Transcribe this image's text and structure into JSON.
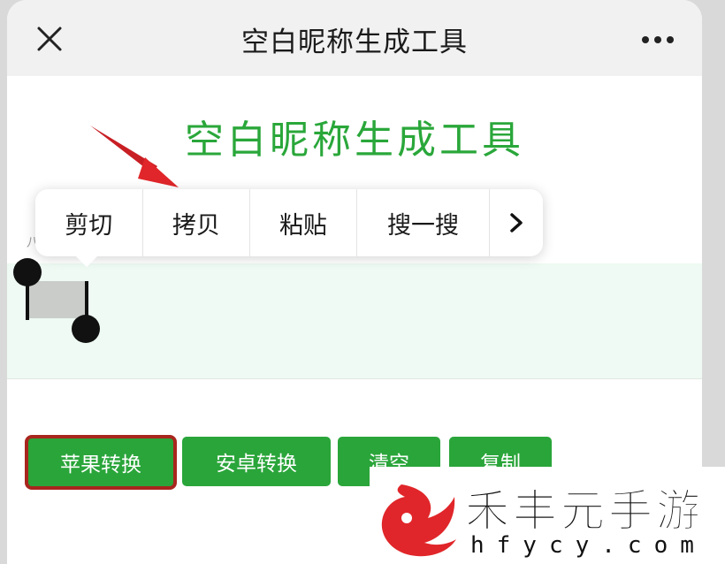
{
  "topbar": {
    "title": "空白昵称生成工具",
    "close_icon": "close-icon",
    "more_icon": "more-dots-icon"
  },
  "main": {
    "title": "空白昵称生成工具",
    "title_color": "#2aa73a"
  },
  "context_menu": {
    "items": [
      {
        "label": "剪切"
      },
      {
        "label": "拷贝"
      },
      {
        "label": "粘贴"
      },
      {
        "label": "搜一搜"
      }
    ],
    "more_icon": "chevron-right-icon"
  },
  "buttons": {
    "apple": "苹果转换",
    "android": "安卓转换",
    "clear": "清空",
    "copy": "复制"
  },
  "watermark": {
    "text": "禾丰元手游",
    "url": "hfycy.com"
  },
  "colors": {
    "accent_green": "#2aa53a",
    "highlight_border": "#a8261e",
    "arrow_red": "#e0262a"
  }
}
